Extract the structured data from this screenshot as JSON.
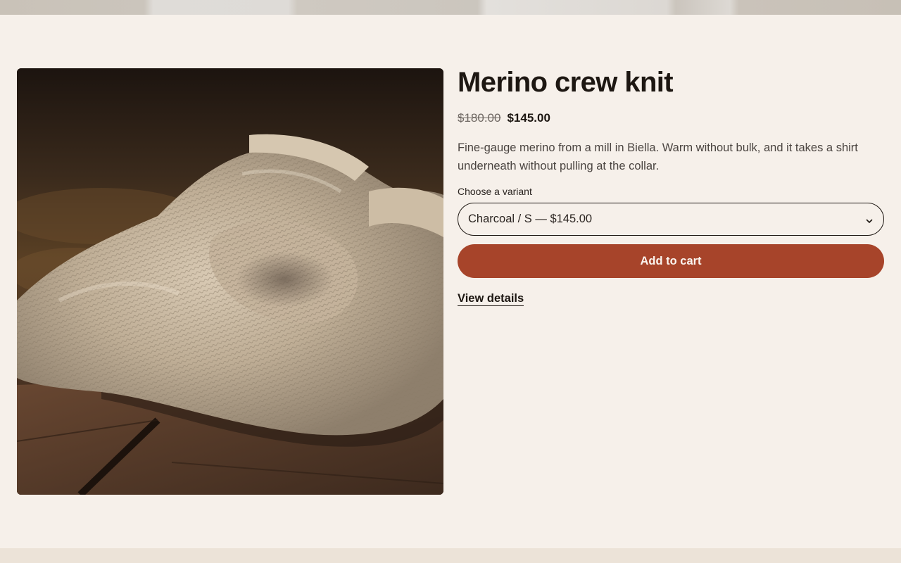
{
  "product": {
    "title": "Merino crew knit",
    "price_compare": "$180.00",
    "price_sale": "$145.00",
    "description": "Fine-gauge merino from a mill in Biella. Warm without bulk, and it takes a shirt underneath without pulling at the collar.",
    "variant_label": "Choose a variant",
    "variant_selected": "Charcoal / S — $145.00",
    "add_to_cart_label": "Add to cart",
    "view_details_label": "View details",
    "image_icon": "knit-sweater-photo"
  },
  "colors": {
    "background": "#f6f0ea",
    "accent": "#a7442a",
    "text": "#1d1712"
  },
  "icons": {
    "variant_chevron": "chevron-down-icon"
  }
}
